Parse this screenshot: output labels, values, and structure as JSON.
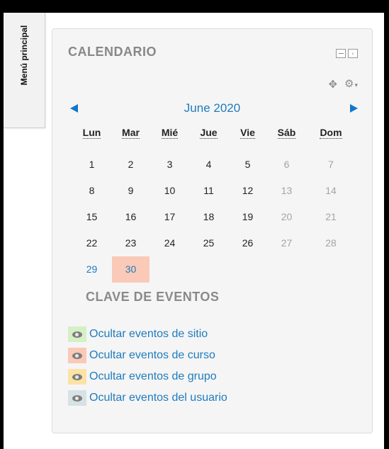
{
  "side_tab": {
    "label": "Menú principal"
  },
  "block": {
    "title": "CALENDARIO",
    "controls": {
      "collapse": "–",
      "dock": "‹"
    },
    "actions": {
      "move_icon": "move-icon",
      "gear_icon": "gear-icon"
    }
  },
  "calendar": {
    "month_label": "June 2020",
    "weekdays": [
      "Lun",
      "Mar",
      "Mié",
      "Jue",
      "Vie",
      "Sáb",
      "Dom"
    ],
    "weeks": [
      [
        "1",
        "2",
        "3",
        "4",
        "5",
        "6",
        "7"
      ],
      [
        "8",
        "9",
        "10",
        "11",
        "12",
        "13",
        "14"
      ],
      [
        "15",
        "16",
        "17",
        "18",
        "19",
        "20",
        "21"
      ],
      [
        "22",
        "23",
        "24",
        "25",
        "26",
        "27",
        "28"
      ],
      [
        "29",
        "30",
        "",
        "",
        "",
        "",
        ""
      ]
    ],
    "today": "30",
    "linked_day": "29"
  },
  "event_key": {
    "title": "CLAVE DE EVENTOS",
    "items": [
      {
        "label": "Ocultar eventos de sitio",
        "color": "#d4f0c4"
      },
      {
        "label": "Ocultar eventos de curso",
        "color": "#fac9b8"
      },
      {
        "label": "Ocultar eventos de grupo",
        "color": "#fbe3a5"
      },
      {
        "label": "Ocultar eventos del usuario",
        "color": "#d6e2e6"
      }
    ]
  },
  "colors": {
    "link": "#1f7bbd",
    "today_bg": "#fac9b8",
    "block_bg": "#f5f5f5"
  }
}
